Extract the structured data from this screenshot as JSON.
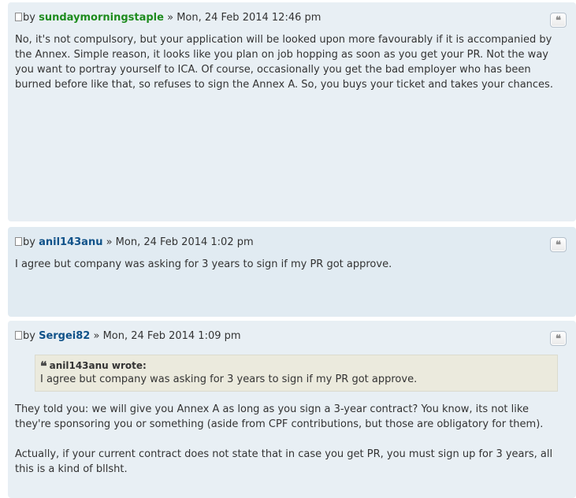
{
  "posts": [
    {
      "author": "sundaymorningstaple",
      "by": "by",
      "date": "» Mon, 24 Feb 2014 12:46 pm",
      "quote_button_label": "❝",
      "paragraphs": [
        "No, it's not compulsory, but your application will be looked upon more favourably if it is accompanied by the Annex. Simple reason, it looks like you plan on job hopping as soon as you get your PR. Not the way you want to portray yourself to ICA. Of course, occasionally you get the bad employer who has been burned before like that, so refuses to sign the Annex A. So, you buys your ticket and takes your chances."
      ]
    },
    {
      "author": "anil143anu",
      "by": "by",
      "date": "» Mon, 24 Feb 2014 1:02 pm",
      "quote_button_label": "❝",
      "paragraphs": [
        "I agree but company was asking for 3 years to sign if my PR got approve."
      ]
    },
    {
      "author": "Sergei82",
      "by": "by",
      "date": "» Mon, 24 Feb 2014 1:09 pm",
      "quote_button_label": "❝",
      "quote": {
        "cite": "anil143anu wrote:",
        "text": "I agree but company was asking for 3 years to sign if my PR got approve."
      },
      "paragraphs": [
        "They told you: we will give you Annex A as long as you sign a 3-year contract? You know, its not like they're sponsoring you or something (aside from CPF contributions, but those are obligatory for them).",
        "Actually, if your current contract does not state that in case you get PR, you must sign up for 3 years, all this is a kind of bllsht."
      ]
    }
  ],
  "colors": {
    "author_moderator": "#1e8c1e",
    "author_user": "#105289",
    "post_bg_1": "#e8eff4",
    "post_bg_2": "#e1ebf2",
    "quote_bg": "#ebeadd"
  },
  "icons": {
    "post": "post-icon",
    "quote_button": "quote-icon",
    "quote_mark": "quote-mark-icon"
  }
}
